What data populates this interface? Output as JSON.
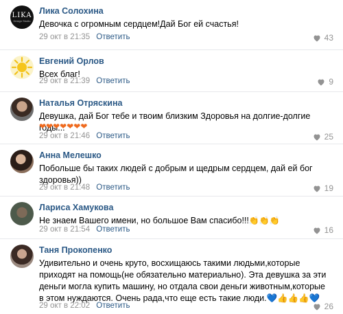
{
  "reply_label": "Ответить",
  "comments": [
    {
      "author": "Лика Солохина",
      "avatar": "lika-logo-avatar",
      "avatar_text": "LIKA",
      "avatar_subtext": "Design Studio",
      "text": "Девочка с огромным сердцем!Дай Бог ей счастья!",
      "time": "29 окт в 21:35",
      "likes": "43"
    },
    {
      "author": "Евгений Орлов",
      "avatar": "sun-avatar",
      "text": "Всех благ!",
      "time": "29 окт в 21:39",
      "likes": "9"
    },
    {
      "author": "Наталья Отряскина",
      "avatar": "photo-avatar",
      "text": "Девушка, дай Бог тебе и твоим близким Здоровья на долгие-долгие годы...",
      "emoji": "❤❤❤❤❤❤❤",
      "time": "29 окт в 21:46",
      "likes": "25"
    },
    {
      "author": "Анна Мелешко",
      "avatar": "photo-avatar",
      "text": "Побольше бы таких людей с добрым и щедрым сердцем, дай ей бог здоровья))",
      "time": "29 окт в 21:48",
      "likes": "19"
    },
    {
      "author": "Лариса Хамукова",
      "avatar": "photo-avatar",
      "text": "Не знаем Вашего имени, но большое Вам спасибо!!!",
      "emoji": "👏👏👏",
      "time": "29 окт в 21:54",
      "likes": "16"
    },
    {
      "author": "Таня Прокопенко",
      "avatar": "photo-avatar",
      "text": "Удивительно и очень круто, восхищаюсь такими людьми,которые приходят на помощь(не обязательно материально). Эта девушка за эти деньги могла купить машину, но отдала свои деньги животным,которые в этом нуждаются. Очень рада,что еще есть такие люди.",
      "emoji": "💙👍👍👍💙",
      "time": "29 окт в 22:02",
      "likes": "26"
    }
  ],
  "colors": {
    "name_link": "#2a5885",
    "meta_gray": "#939393",
    "divider": "#e7e8ec"
  },
  "icons": {
    "like": "heart-icon"
  }
}
